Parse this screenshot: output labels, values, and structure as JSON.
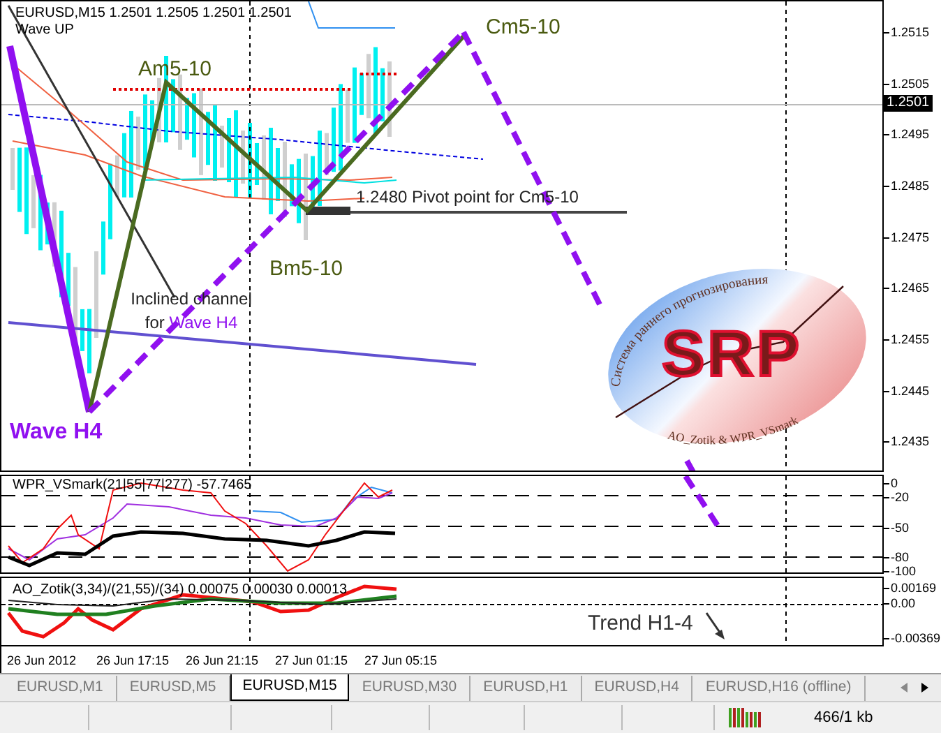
{
  "chart": {
    "symbol_info": "EURUSD,M15  1.2501 1.2505 1.2501 1.2501",
    "indicator": "Wave UP",
    "price_ticks": [
      "1.2515",
      "1.2505",
      "1.2495",
      "1.2485",
      "1.2475",
      "1.2465",
      "1.2455",
      "1.2445",
      "1.2435"
    ],
    "current_price": "1.2501",
    "annotations": [
      {
        "kind": "wave",
        "text": "Am5-10"
      },
      {
        "kind": "wave",
        "text": "Cm5-10"
      },
      {
        "kind": "wave",
        "text": "Bm5-10"
      },
      {
        "kind": "pivot",
        "text": "1.2480 Pivot point for Cm5-10"
      },
      {
        "kind": "channel",
        "text": "Inclined channel for",
        "highlight": "Wave H4"
      },
      {
        "kind": "major",
        "text": "Wave H4"
      }
    ]
  },
  "logo": {
    "arc_text": "Система раннего прогнозирования",
    "letters": "SRP",
    "footer": "AO_Zotik & WPR_VSmark"
  },
  "wpr_panel": {
    "title": "WPR_VSmark(21|55|77|277) -57.7465",
    "ticks": [
      "0",
      "-20",
      "-50",
      "-80",
      "-100"
    ]
  },
  "ao_panel": {
    "title": "AO_Zotik(3,34)/(21,55)/(34) 0.00075 0.00030 0.00013",
    "ticks": [
      "0.00169",
      "0.00",
      "-0.00369"
    ],
    "annotation": "Trend H1-4"
  },
  "time_axis": [
    "26 Jun 2012",
    "26 Jun 17:15",
    "26 Jun 21:15",
    "27 Jun 01:15",
    "27 Jun 05:15"
  ],
  "tabs": [
    {
      "label": "EURUSD,M1",
      "selected": false
    },
    {
      "label": "EURUSD,M5",
      "selected": false
    },
    {
      "label": "EURUSD,M15",
      "selected": true
    },
    {
      "label": "EURUSD,M30",
      "selected": false
    },
    {
      "label": "EURUSD,H1",
      "selected": false
    },
    {
      "label": "EURUSD,H4",
      "selected": false
    },
    {
      "label": "EURUSD,H16 (offline)",
      "selected": false
    }
  ],
  "status_bar": {
    "traffic": "466/1 kb"
  }
}
